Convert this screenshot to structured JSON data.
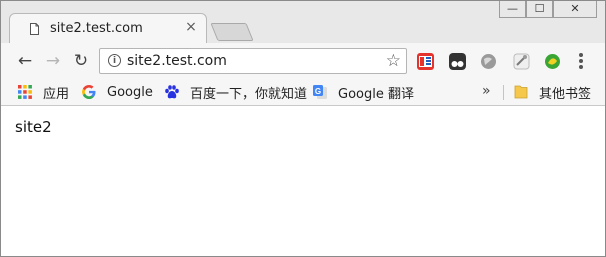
{
  "tab": {
    "title": "site2.test.com",
    "close_symbol": "×"
  },
  "window_controls": {
    "minimize": "—",
    "maximize": "☐",
    "close": "✕"
  },
  "toolbar": {
    "back_symbol": "←",
    "forward_symbol": "→",
    "reload_symbol": "↻",
    "url": "site2.test.com",
    "info_symbol": "i",
    "star_symbol": "☆"
  },
  "bookmarks": {
    "items": [
      {
        "label": "应用",
        "icon": "apps-grid-icon"
      },
      {
        "label": "Google",
        "icon": "google-g-icon"
      },
      {
        "label": "百度一下，你就知道",
        "icon": "baidu-paw-icon"
      },
      {
        "label": "Google 翻译",
        "icon": "google-translate-icon"
      }
    ],
    "overflow_symbol": "»",
    "other_folder": "其他书签"
  },
  "page": {
    "text": "site2"
  },
  "colors": {
    "tab_strip": "#e8e8e8",
    "toolbar": "#f6f6f6",
    "google_blue": "#4285f4",
    "google_red": "#ea4335",
    "google_yellow": "#fbbc05",
    "google_green": "#34a853",
    "baidu_blue": "#2932e1",
    "folder_yellow": "#f5c84c"
  }
}
